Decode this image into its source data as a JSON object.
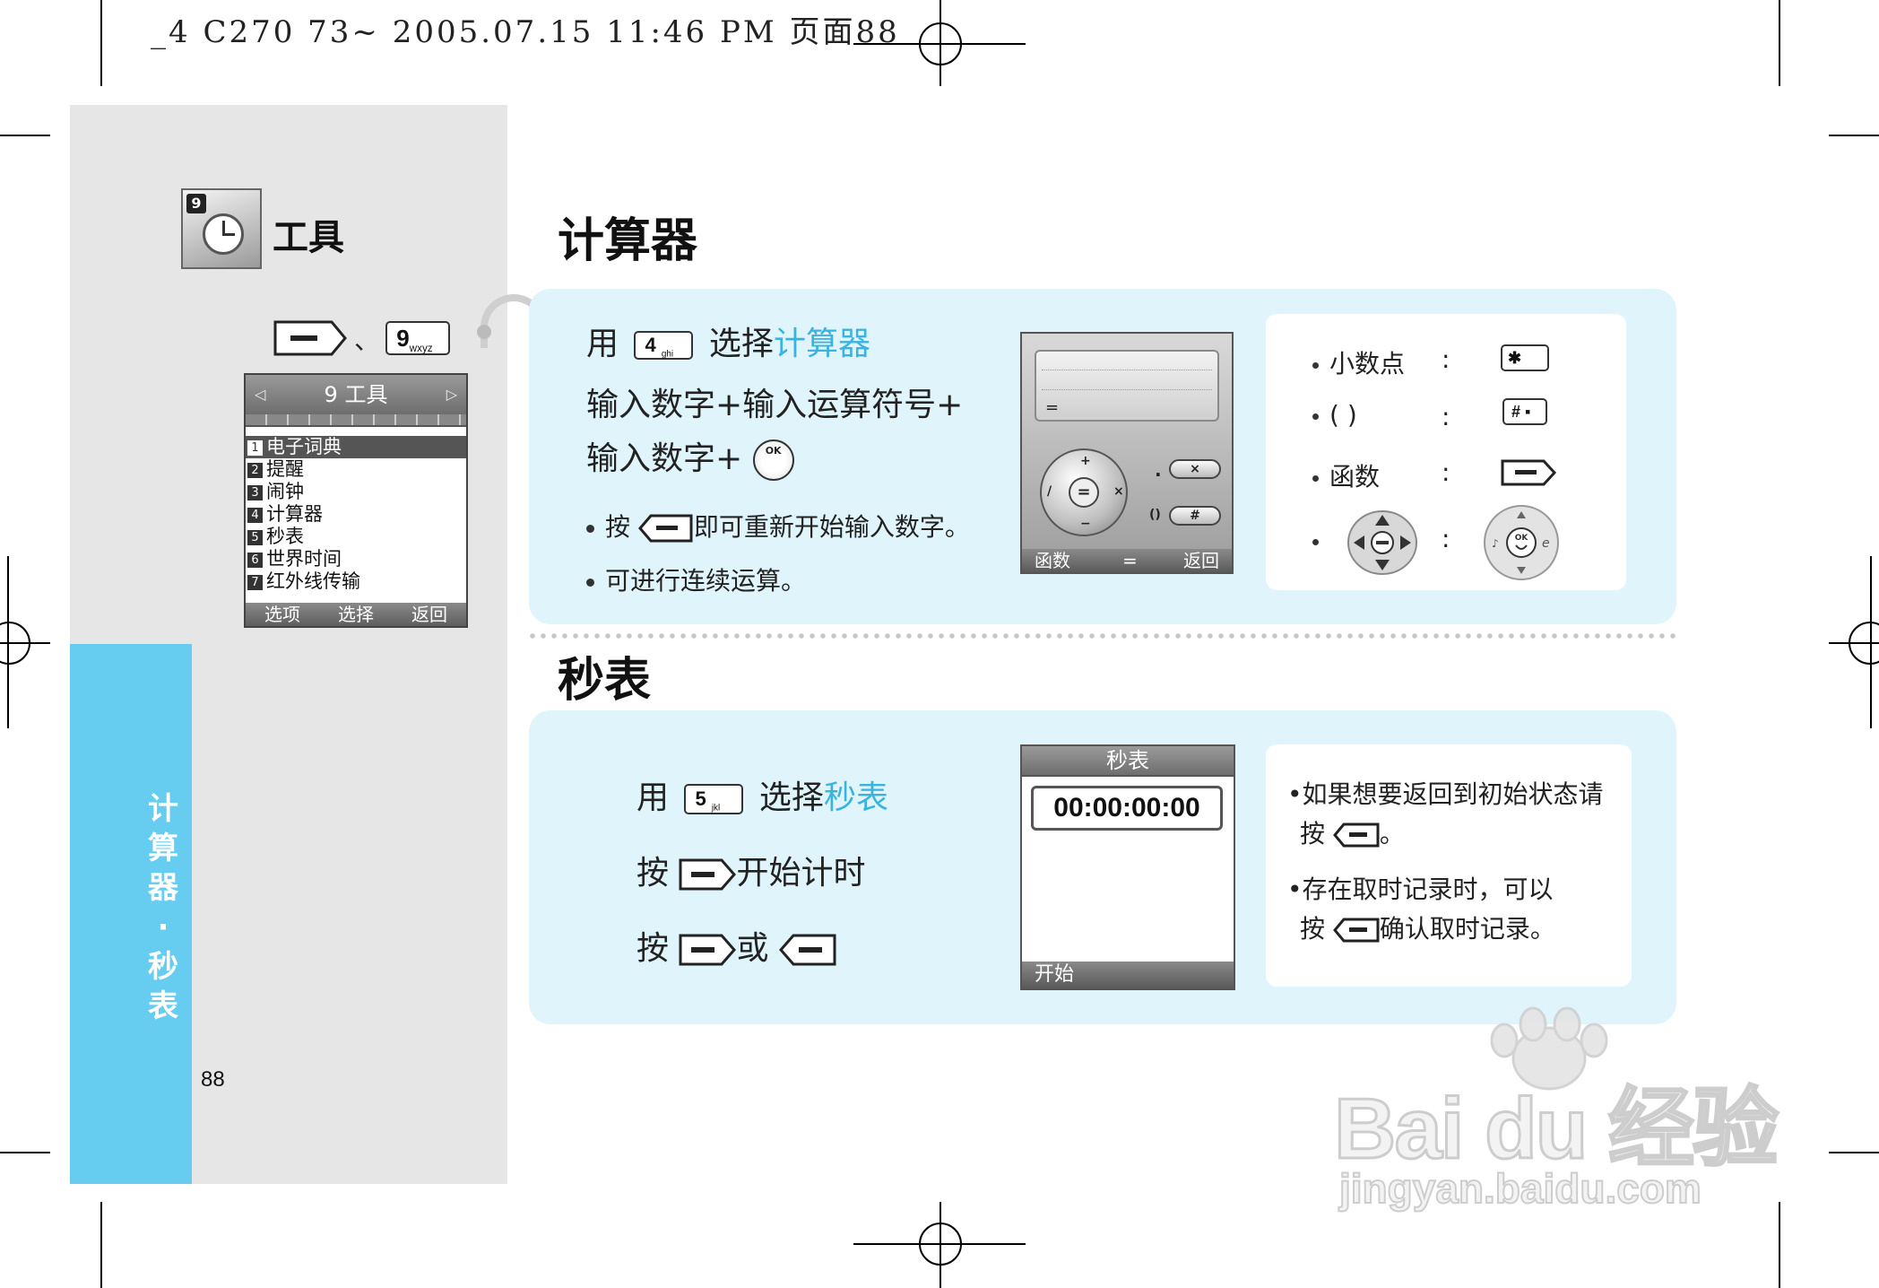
{
  "print_header": "_4 C270 73~ 2005.07.15 11:46 PM 页面88",
  "section": {
    "title": "工具",
    "side_tab_text": "计算器·秒表",
    "page_number": "88",
    "key_separator": "、",
    "menu_key": {
      "main": "9",
      "sub": "wxyz"
    }
  },
  "menu_screen": {
    "title": "9 工具",
    "items": [
      {
        "num": "1",
        "label": "电子词典"
      },
      {
        "num": "2",
        "label": "提醒"
      },
      {
        "num": "3",
        "label": "闹钟"
      },
      {
        "num": "4",
        "label": "计算器"
      },
      {
        "num": "5",
        "label": "秒表"
      },
      {
        "num": "6",
        "label": "世界时间"
      },
      {
        "num": "7",
        "label": "红外线传输"
      }
    ],
    "selected_index": 0,
    "softkeys": [
      "选项",
      "选择",
      "返回"
    ]
  },
  "calculator": {
    "heading": "计算器",
    "select_prefix": "用",
    "key": {
      "main": "4",
      "sub": "ghi"
    },
    "select_text": "选择",
    "select_target": "计算器",
    "line2": "输入数字+输入运算符号+",
    "line3": "输入数字+",
    "ok_label": "OK",
    "tip1_prefix": "按",
    "tip1_suffix": "即可重新开始输入数字。",
    "tip2": "可进行连续运算。",
    "screen": {
      "display_symbol": "=",
      "ops": {
        "plus": "+",
        "minus": "−",
        "times": "×",
        "divide": "/",
        "equals": "="
      },
      "dot": ".",
      "parens": "()",
      "clear_key": "×",
      "hash_key": "#",
      "softkeys": [
        "函数",
        "=",
        "返回"
      ]
    },
    "legend": [
      {
        "label": "小数点",
        "colon": ":",
        "key": "✱"
      },
      {
        "label": "(  )",
        "colon": ":",
        "key": "# ▪"
      },
      {
        "label": "函数",
        "colon": ":",
        "key": "softkey"
      },
      {
        "label": "",
        "colon": ":",
        "key": "navpad"
      }
    ]
  },
  "stopwatch": {
    "heading": "秒表",
    "select_prefix": "用",
    "key": {
      "main": "5",
      "sub": "jkl"
    },
    "select_text": "选择",
    "select_target": "秒表",
    "line2_prefix": "按",
    "line2_suffix": "开始计时",
    "line3_prefix": "按",
    "line3_mid": "或",
    "screen": {
      "title": "秒表",
      "time": "00:00:00:00",
      "softkey": "开始"
    },
    "notes": {
      "note1_a": "•如果想要返回到初始状态请",
      "note1_b_prefix": "按",
      "note1_b_suffix": "。",
      "note2_a": "•存在取时记录时，可以",
      "note2_b_prefix": "按",
      "note2_b_suffix": "确认取时记录。"
    }
  },
  "watermark": {
    "brand": "Bai du 经验",
    "url": "jingyan.baidu.com"
  },
  "colors": {
    "accent": "#3ab3e0",
    "side_tab": "#66ccf0",
    "panel_bg": "#e0f4fb",
    "left_col": "#e6e6e6"
  }
}
